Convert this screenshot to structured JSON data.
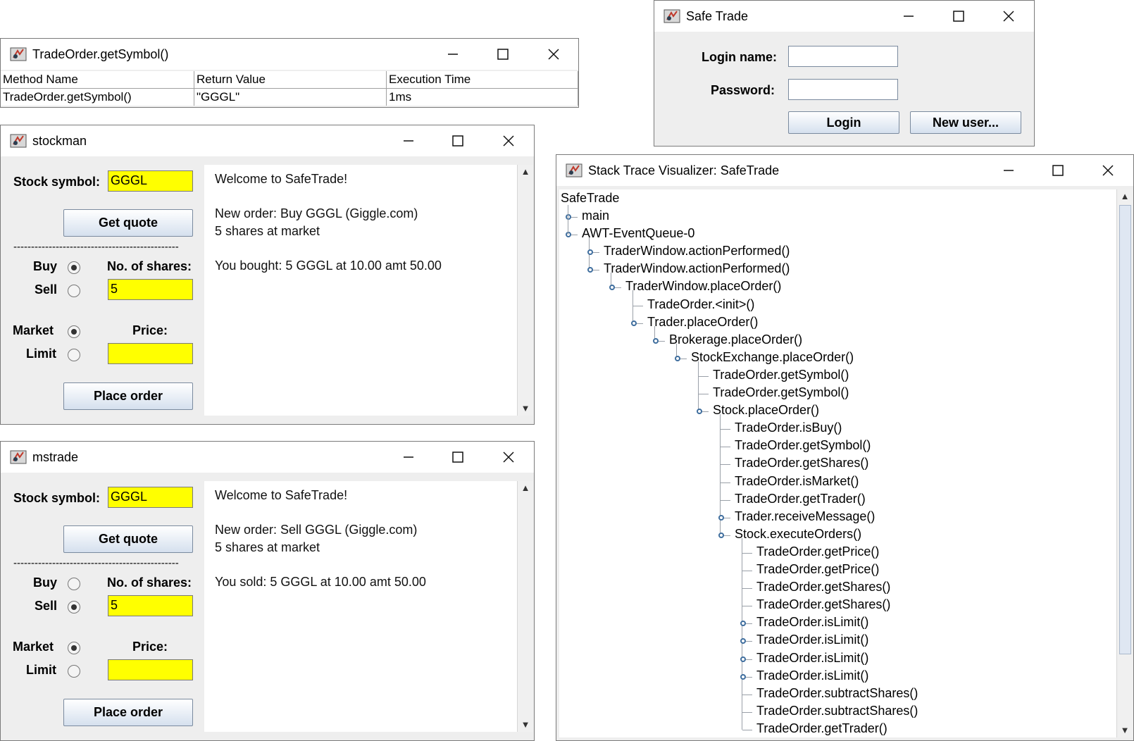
{
  "windows": {
    "trace_table": {
      "title": "TradeOrder.getSymbol()",
      "columns": [
        "Method Name",
        "Return Value",
        "Execution Time"
      ],
      "row": [
        "TradeOrder.getSymbol()",
        "\"GGGL\"",
        "1ms"
      ]
    },
    "stockman": {
      "title": "stockman",
      "symbol_label": "Stock symbol:",
      "symbol_value": "GGGL",
      "get_quote": "Get quote",
      "dashes": "-----------------------------------------------",
      "buy_label": "Buy",
      "sell_label": "Sell",
      "shares_label": "No. of shares:",
      "shares_value": "5",
      "market_label": "Market",
      "limit_label": "Limit",
      "price_label": "Price:",
      "price_value": "",
      "place_order": "Place order",
      "side_selected": "Buy",
      "type_selected": "Market",
      "messages": [
        "Welcome to SafeTrade!",
        "New order: Buy GGGL (Giggle.com)",
        "5 shares at market",
        "You bought: 5 GGGL at 10.00 amt 50.00"
      ]
    },
    "mstrade": {
      "title": "mstrade",
      "symbol_label": "Stock symbol:",
      "symbol_value": "GGGL",
      "get_quote": "Get quote",
      "dashes": "-----------------------------------------------",
      "buy_label": "Buy",
      "sell_label": "Sell",
      "shares_label": "No. of shares:",
      "shares_value": "5",
      "market_label": "Market",
      "limit_label": "Limit",
      "price_label": "Price:",
      "price_value": "",
      "place_order": "Place order",
      "side_selected": "Sell",
      "type_selected": "Market",
      "messages": [
        "Welcome to SafeTrade!",
        "New order: Sell GGGL (Giggle.com)",
        "5 shares at market",
        "You sold: 5 GGGL at 10.00 amt 50.00"
      ]
    },
    "login": {
      "title": "Safe Trade",
      "login_label": "Login name:",
      "password_label": "Password:",
      "login_button": "Login",
      "new_user_button": "New user..."
    },
    "visualizer": {
      "title": "Stack Trace Visualizer: SafeTrade",
      "root": "SafeTrade",
      "nodes": [
        {
          "label": "main",
          "depth": 0,
          "state": "collapsed"
        },
        {
          "label": "AWT-EventQueue-0",
          "depth": 0,
          "state": "expanded"
        },
        {
          "label": "TraderWindow.actionPerformed()",
          "depth": 1,
          "state": "collapsed"
        },
        {
          "label": "TraderWindow.actionPerformed()",
          "depth": 1,
          "state": "expanded"
        },
        {
          "label": "TraderWindow.placeOrder()",
          "depth": 2,
          "state": "expanded"
        },
        {
          "label": "TradeOrder.<init>()",
          "depth": 3,
          "state": "leaf"
        },
        {
          "label": "Trader.placeOrder()",
          "depth": 3,
          "state": "expanded"
        },
        {
          "label": "Brokerage.placeOrder()",
          "depth": 4,
          "state": "expanded"
        },
        {
          "label": "StockExchange.placeOrder()",
          "depth": 5,
          "state": "expanded"
        },
        {
          "label": "TradeOrder.getSymbol()",
          "depth": 6,
          "state": "leaf"
        },
        {
          "label": "TradeOrder.getSymbol()",
          "depth": 6,
          "state": "leaf"
        },
        {
          "label": "Stock.placeOrder()",
          "depth": 6,
          "state": "expanded"
        },
        {
          "label": "TradeOrder.isBuy()",
          "depth": 7,
          "state": "leaf"
        },
        {
          "label": "TradeOrder.getSymbol()",
          "depth": 7,
          "state": "leaf"
        },
        {
          "label": "TradeOrder.getShares()",
          "depth": 7,
          "state": "leaf"
        },
        {
          "label": "TradeOrder.isMarket()",
          "depth": 7,
          "state": "leaf"
        },
        {
          "label": "TradeOrder.getTrader()",
          "depth": 7,
          "state": "leaf"
        },
        {
          "label": "Trader.receiveMessage()",
          "depth": 7,
          "state": "collapsed"
        },
        {
          "label": "Stock.executeOrders()",
          "depth": 7,
          "state": "expanded"
        },
        {
          "label": "TradeOrder.getPrice()",
          "depth": 8,
          "state": "leaf"
        },
        {
          "label": "TradeOrder.getPrice()",
          "depth": 8,
          "state": "leaf"
        },
        {
          "label": "TradeOrder.getShares()",
          "depth": 8,
          "state": "leaf"
        },
        {
          "label": "TradeOrder.getShares()",
          "depth": 8,
          "state": "leaf"
        },
        {
          "label": "TradeOrder.isLimit()",
          "depth": 8,
          "state": "collapsed"
        },
        {
          "label": "TradeOrder.isLimit()",
          "depth": 8,
          "state": "collapsed"
        },
        {
          "label": "TradeOrder.isLimit()",
          "depth": 8,
          "state": "collapsed"
        },
        {
          "label": "TradeOrder.isLimit()",
          "depth": 8,
          "state": "collapsed"
        },
        {
          "label": "TradeOrder.subtractShares()",
          "depth": 8,
          "state": "leaf"
        },
        {
          "label": "TradeOrder.subtractShares()",
          "depth": 8,
          "state": "leaf"
        },
        {
          "label": "TradeOrder.getTrader()",
          "depth": 8,
          "state": "leaf"
        }
      ]
    }
  },
  "icons": {
    "app": "java-app-icon",
    "minimize": "minimize-icon",
    "maximize": "maximize-icon",
    "close": "close-icon"
  },
  "colors": {
    "field_highlight": "#ffff00",
    "tree_knob": "#3f6e9e",
    "button_gradient_bottom": "#d5e0ee"
  }
}
